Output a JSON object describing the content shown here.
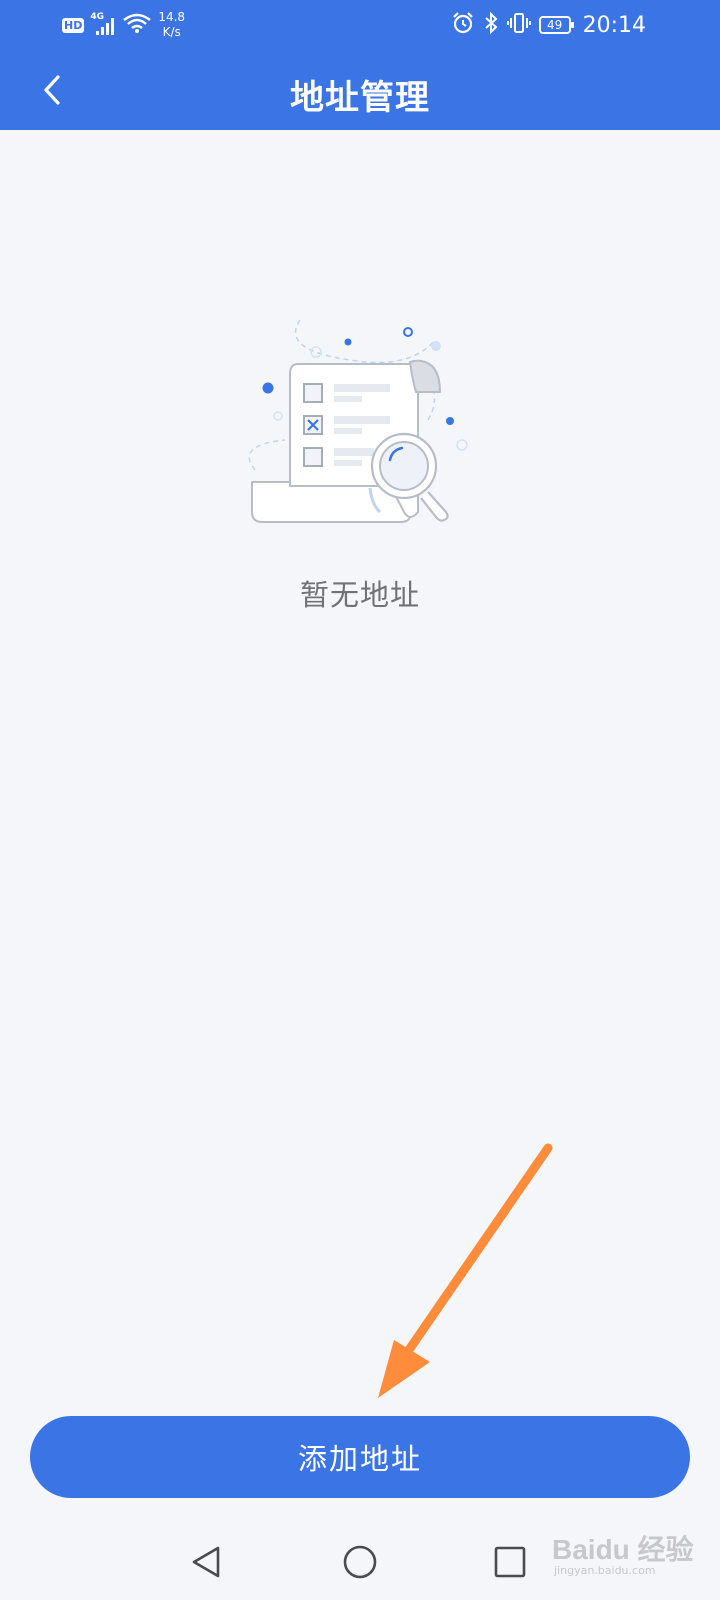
{
  "status_bar": {
    "hd": "HD",
    "network": "4G",
    "speed_value": "14.8",
    "speed_unit": "K/s",
    "battery": "49",
    "time": "20:14",
    "icons": [
      "signal-icon",
      "wifi-icon",
      "alarm-icon",
      "bluetooth-icon",
      "vibrate-icon",
      "battery-icon"
    ]
  },
  "header": {
    "title": "地址管理",
    "back_icon": "chevron-left-icon"
  },
  "empty_state": {
    "illustration": "empty-document-search-illustration",
    "text": "暂无地址"
  },
  "footer": {
    "add_button_label": "添加地址"
  },
  "nav_bar": {
    "icons": [
      "back-triangle-icon",
      "home-circle-icon",
      "recents-square-icon"
    ]
  },
  "watermark": {
    "main": "Baidu 经验",
    "sub": "jingyan.baidu.com"
  },
  "colors": {
    "primary": "#3B74E5",
    "background": "#F5F6FA",
    "empty_text": "#717176",
    "annotation_arrow": "#FF8C3A"
  }
}
